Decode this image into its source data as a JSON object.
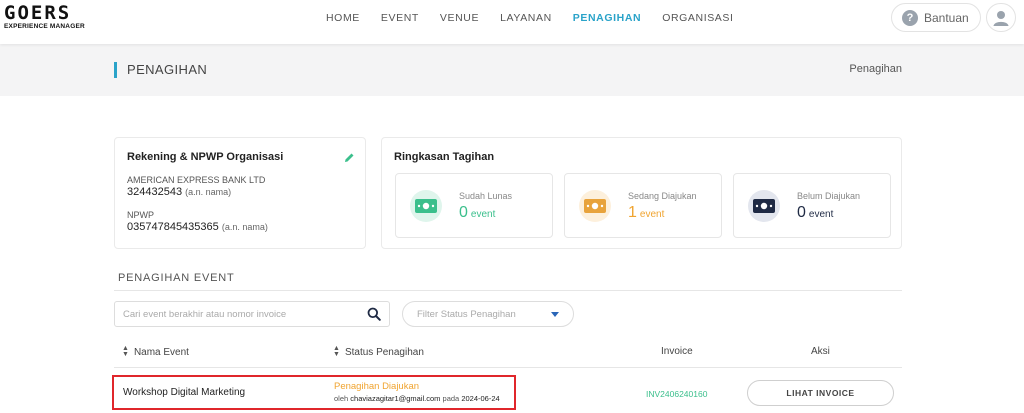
{
  "brand": {
    "name": "GOERS",
    "tagline": "EXPERIENCE MANAGER"
  },
  "nav": {
    "items": [
      {
        "label": "HOME",
        "active": false
      },
      {
        "label": "EVENT",
        "active": false
      },
      {
        "label": "VENUE",
        "active": false
      },
      {
        "label": "LAYANAN",
        "active": false
      },
      {
        "label": "PENAGIHAN",
        "active": true
      },
      {
        "label": "ORGANISASI",
        "active": false
      }
    ],
    "help_label": "Bantuan",
    "help_icon": "question-circle-icon",
    "avatar_icon": "user-icon"
  },
  "page": {
    "title": "PENAGIHAN",
    "breadcrumb": "Penagihan"
  },
  "account_card": {
    "title": "Rekening & NPWP Organisasi",
    "edit_icon": "pencil-icon",
    "bank_name": "AMERICAN EXPRESS BANK LTD",
    "account_number": "324432543",
    "account_holder": "(a.n. nama)",
    "npwp_label": "NPWP",
    "npwp_number": "035747845435365",
    "npwp_holder": "(a.n. nama)"
  },
  "summary_card": {
    "title": "Ringkasan Tagihan",
    "stats": [
      {
        "label": "Sudah Lunas",
        "value": "0",
        "unit": "event",
        "color": "#3bbf8c",
        "icon": "money-icon"
      },
      {
        "label": "Sedang Diajukan",
        "value": "1",
        "unit": "event",
        "color": "#f0a430",
        "icon": "money-icon"
      },
      {
        "label": "Belum Diajukan",
        "value": "0",
        "unit": "event",
        "color": "#1f2a44",
        "icon": "money-icon"
      }
    ]
  },
  "section": {
    "title": "PENAGIHAN EVENT"
  },
  "search": {
    "placeholder": "Cari event berakhir atau nomor invoice",
    "value": ""
  },
  "filter": {
    "label": "Filter Status Penagihan"
  },
  "table": {
    "headers": {
      "event": "Nama Event",
      "status": "Status Penagihan",
      "invoice": "Invoice",
      "action": "Aksi"
    },
    "rows": [
      {
        "event": "Workshop Digital Marketing",
        "status": "Penagihan Diajukan",
        "status_prefix": "oleh",
        "status_email": "chaviazagitar1@gmail.com",
        "status_mid": "pada",
        "status_date": "2024-06-24",
        "invoice": "INV2406240160",
        "action": "LIHAT INVOICE"
      }
    ]
  },
  "colors": {
    "accent": "#2aa3c9",
    "highlight": "#e0262b",
    "paid": "#3bbf8c",
    "pending": "#f0a430",
    "unsubmitted": "#1f2a44"
  }
}
